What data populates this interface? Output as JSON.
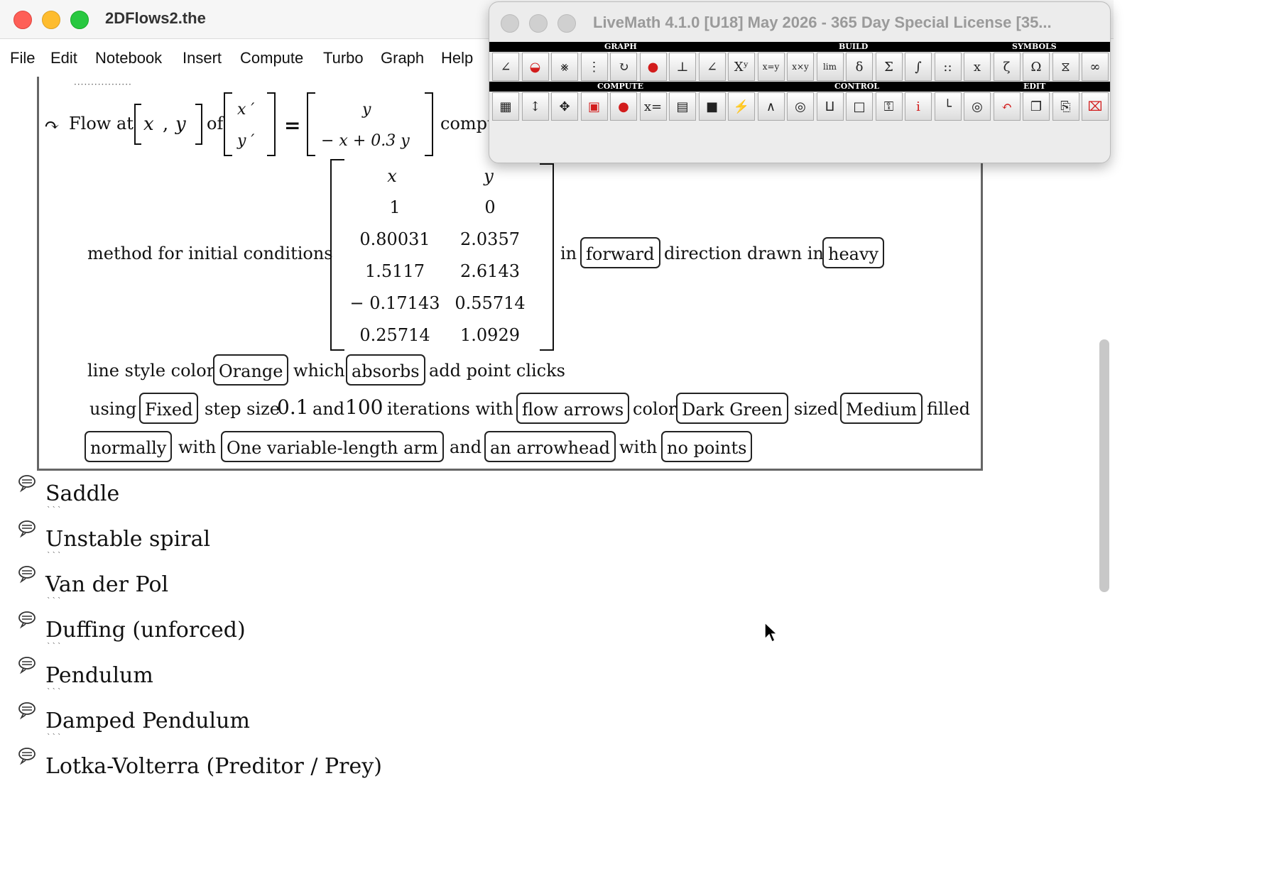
{
  "window": {
    "title": "2DFlows2.the",
    "menu": [
      "File",
      "Edit",
      "Notebook",
      "Insert",
      "Compute",
      "Turbo",
      "Graph",
      "Help"
    ]
  },
  "flow": {
    "prefix": "Flow at",
    "vars": [
      "x",
      ",",
      "y"
    ],
    "of": "of",
    "lhs": [
      "x ′",
      "y ′"
    ],
    "equals": "=",
    "rhs_top": "y",
    "rhs_bottom": "− x  + 0.3 y",
    "trailing": "compu"
  },
  "method": {
    "label": "method for initial conditions",
    "headers": [
      "x",
      "y"
    ],
    "rows": [
      [
        "1",
        "0"
      ],
      [
        "0.80031",
        "2.0357"
      ],
      [
        "1.5117",
        "2.6143"
      ],
      [
        "− 0.17143",
        "0.55714"
      ],
      [
        "0.25714",
        "1.0929"
      ]
    ],
    "in": "in",
    "direction": "forward",
    "direction_text": "direction drawn in",
    "weight": "heavy"
  },
  "style_line": {
    "line_style_color": "line style color",
    "color": "Orange",
    "which": "which",
    "absorbs": "absorbs",
    "add_point": "add point clicks"
  },
  "using_line": {
    "using": "using",
    "method": "Fixed",
    "step_size_label": "step size",
    "step_size": "0.1",
    "and": "and",
    "iterations": "100",
    "iterations_with": "iterations with",
    "flow_arrows": "flow arrows",
    "color": "color",
    "arrow_color": "Dark Green",
    "sized": "sized",
    "size": "Medium",
    "filled": "filled"
  },
  "last_line": {
    "normally": "normally",
    "with1": "with",
    "arm": "One variable-length arm",
    "and": "and",
    "arrowhead": "an arrowhead",
    "with2": "with",
    "points": "no points"
  },
  "sections": [
    "Saddle",
    "Unstable spiral",
    "Van der Pol",
    "Duffing (unforced)",
    "Pendulum",
    "Damped Pendulum",
    "Lotka-Volterra (Preditor / Prey)"
  ],
  "palette": {
    "title": "LiveMath 4.1.0 [U18] May 2026 - 365 Day Special License  [35...",
    "groups": [
      "GRAPH",
      "BUILD",
      "SYMBOLS",
      "COMPUTE",
      "CONTROL",
      "EDIT"
    ],
    "row1_glyphs": [
      "∠",
      "◒",
      "⨳",
      "⋮",
      "↻",
      "●",
      "⊥",
      "∠",
      "Xʸ",
      "x=y",
      "x×y",
      "lim",
      "δ",
      "Σ",
      "∫",
      "::",
      "x",
      "ζ",
      "Ω",
      "⧖",
      "∞"
    ],
    "row2_glyphs": [
      "▦",
      "↕",
      "✥",
      "▣",
      "●",
      "x=",
      "▤",
      "■",
      "⚡",
      "∧",
      "◎",
      "⨿",
      "□",
      "⚿",
      "i",
      "└",
      "◎",
      "↶",
      "❐",
      "⎘",
      "⌧"
    ]
  },
  "colors": {
    "close": "#fe5f57",
    "minimize": "#febc2e",
    "zoom": "#28c840"
  }
}
